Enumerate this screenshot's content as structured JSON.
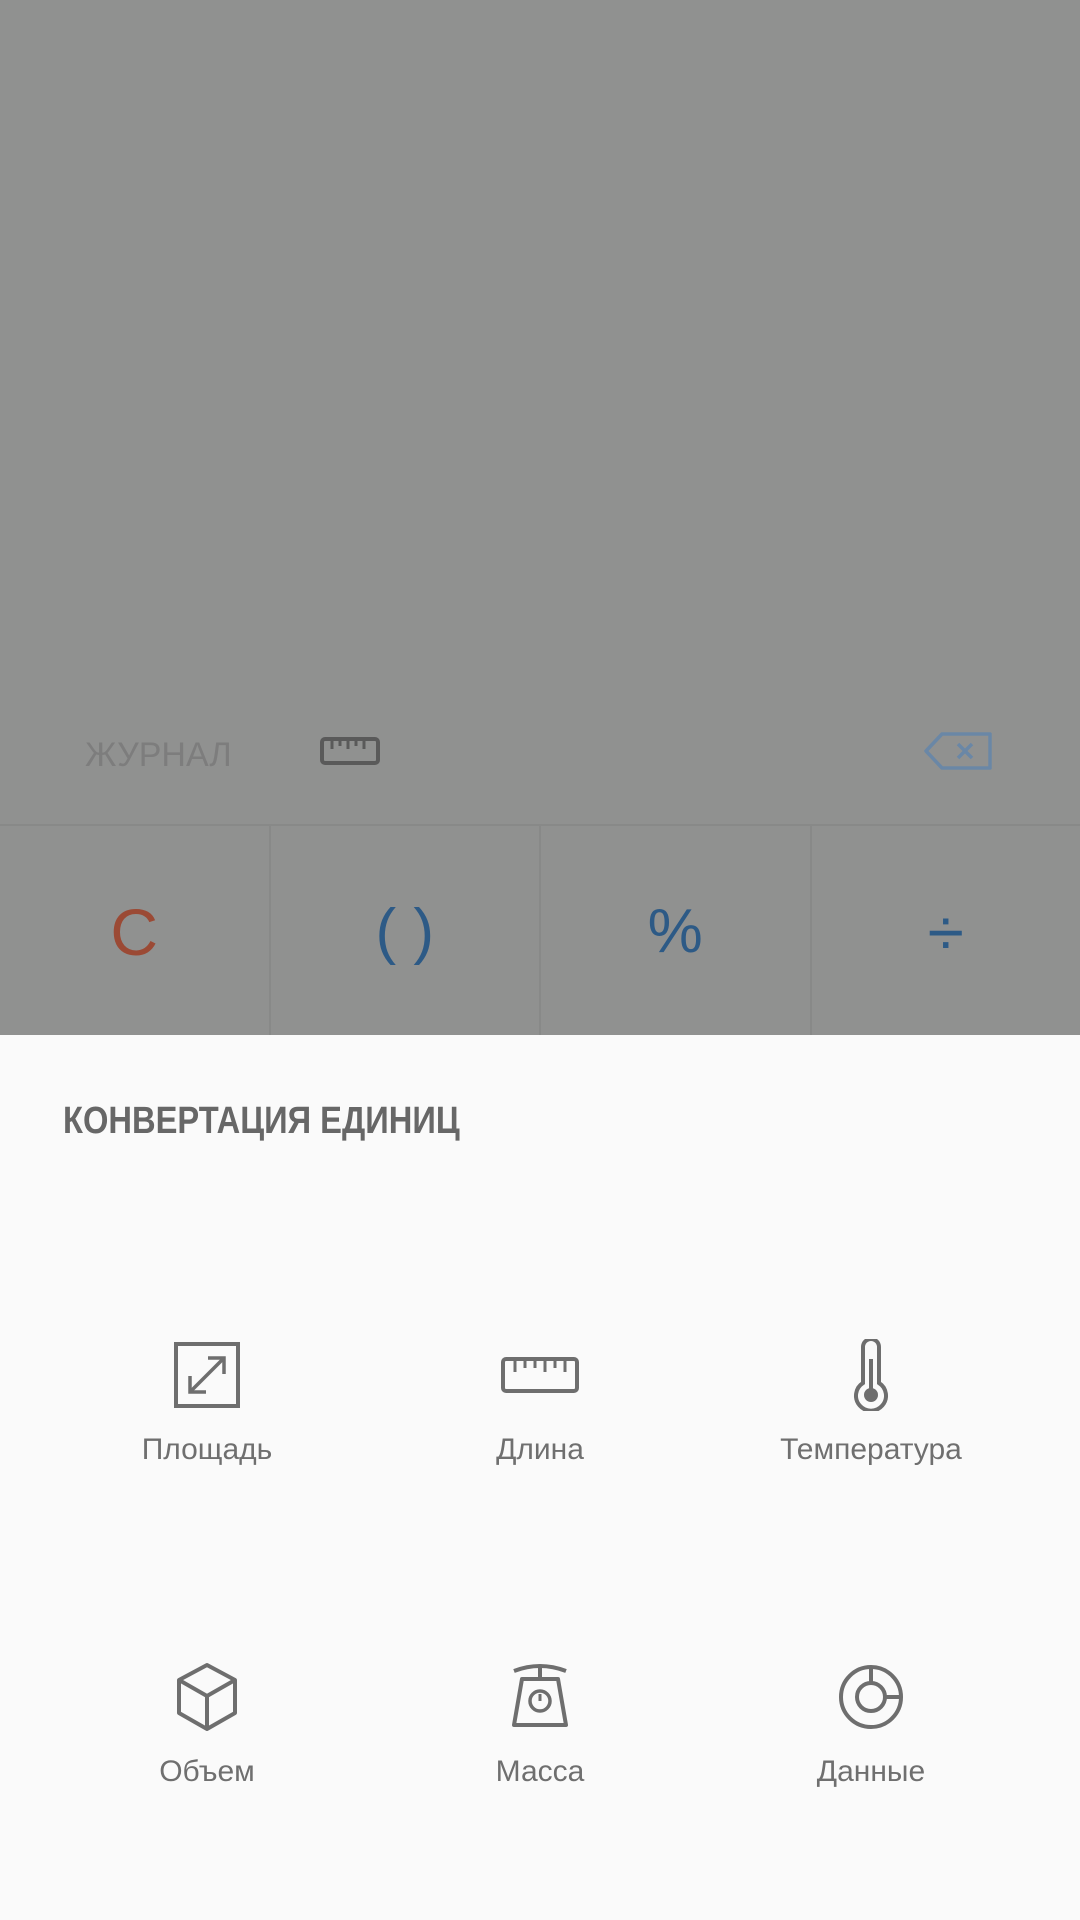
{
  "calculator": {
    "history_label": "ЖУРНАЛ",
    "keys": {
      "clear": "C",
      "parentheses": "( )",
      "percent": "%",
      "divide": "÷"
    }
  },
  "converter": {
    "title": "КОНВЕРТАЦИЯ ЕДИНИЦ",
    "units": [
      {
        "label": "Площадь",
        "icon": "area-icon"
      },
      {
        "label": "Длина",
        "icon": "length-ruler-icon"
      },
      {
        "label": "Температура",
        "icon": "thermometer-icon"
      },
      {
        "label": "Объем",
        "icon": "cube-icon"
      },
      {
        "label": "Масса",
        "icon": "scale-icon"
      },
      {
        "label": "Данные",
        "icon": "data-pie-icon"
      }
    ]
  },
  "colors": {
    "overlay": "#909190",
    "sheet_bg": "#fafafa",
    "key_blue": "#2d5a86",
    "key_clear": "#9b4a35",
    "label_gray": "#6f6f6f"
  }
}
